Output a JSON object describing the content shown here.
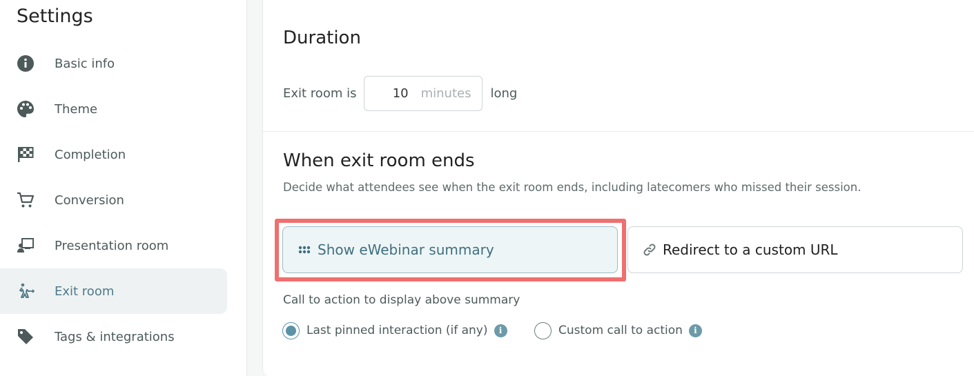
{
  "sidebar": {
    "title": "Settings",
    "items": [
      {
        "label": "Basic info",
        "icon": "info-circle-icon"
      },
      {
        "label": "Theme",
        "icon": "palette-icon"
      },
      {
        "label": "Completion",
        "icon": "checkered-flag-icon"
      },
      {
        "label": "Conversion",
        "icon": "shopping-cart-icon"
      },
      {
        "label": "Presentation room",
        "icon": "presenter-icon"
      },
      {
        "label": "Exit room",
        "icon": "walking-exit-icon",
        "active": true
      },
      {
        "label": "Tags & integrations",
        "icon": "tag-icon"
      }
    ]
  },
  "duration": {
    "title": "Duration",
    "prefix": "Exit room is",
    "value": "10",
    "unit": "minutes",
    "suffix": "long"
  },
  "exit_end": {
    "title": "When exit room ends",
    "description": "Decide what attendees see when the exit room ends, including latecomers who missed their session.",
    "options": [
      {
        "label": "Show eWebinar summary",
        "icon": "grid-dots-icon",
        "selected": true
      },
      {
        "label": "Redirect to a custom URL",
        "icon": "link-icon",
        "selected": false
      }
    ],
    "cta_label": "Call to action to display above summary",
    "radios": [
      {
        "label": "Last pinned interaction (if any)",
        "checked": true
      },
      {
        "label": "Custom call to action",
        "checked": false
      }
    ]
  },
  "colors": {
    "accent": "#5b93a6",
    "highlight": "#f06f6f",
    "selected_bg": "#eef5f6"
  }
}
